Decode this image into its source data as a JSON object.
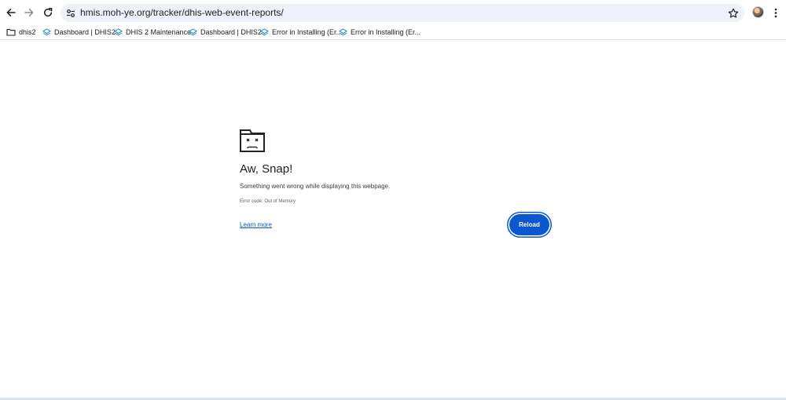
{
  "toolbar": {
    "back_icon": "arrow-left-icon",
    "forward_icon": "arrow-right-icon",
    "reload_icon": "reload-icon",
    "url": "hmis.moh-ye.org/tracker/dhis-web-event-reports/",
    "site_info_icon": "tune-icon",
    "star_icon": "star-outline-icon",
    "menu_icon": "kebab-menu-icon"
  },
  "bookmarks": [
    {
      "label": "dhis2",
      "icon": "folder-icon"
    },
    {
      "label": "Dashboard | DHIS2",
      "icon": "dhis2-icon"
    },
    {
      "label": "DHIS 2 Maintenance",
      "icon": "dhis2-icon"
    },
    {
      "label": "Dashboard | DHIS2",
      "icon": "dhis2-icon"
    },
    {
      "label": "Error in Installing (Er...",
      "icon": "dhis2-icon"
    },
    {
      "label": "Error in Installing (Er...",
      "icon": "dhis2-icon"
    }
  ],
  "error_page": {
    "icon": "sad-tab-icon",
    "title": "Aw, Snap!",
    "message": "Something went wrong while displaying this webpage.",
    "error_code": "Error code: Out of Memory",
    "learn_more": "Learn more",
    "reload_label": "Reload"
  },
  "colors": {
    "accent": "#0b57d0",
    "omnibox_bg": "#eef1f8",
    "bookmark_icon": "#1a8fc7"
  }
}
